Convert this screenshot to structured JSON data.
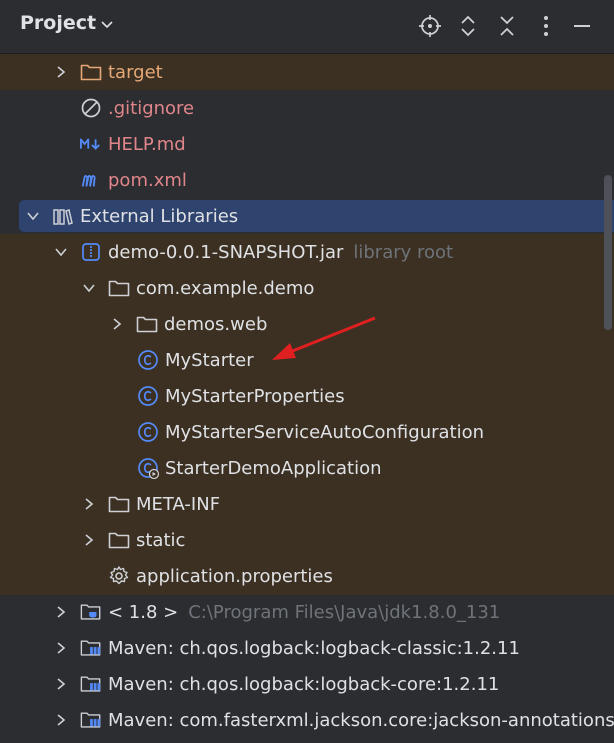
{
  "header": {
    "title": "Project"
  },
  "tree": [
    {
      "label": "target"
    },
    {
      "label": ".gitignore"
    },
    {
      "label": "HELP.md"
    },
    {
      "label": "pom.xml"
    },
    {
      "label": "External Libraries"
    },
    {
      "label": "demo-0.0.1-SNAPSHOT.jar",
      "hint": "library root"
    },
    {
      "label": "com.example.demo"
    },
    {
      "label": "demos.web"
    },
    {
      "label": "MyStarter"
    },
    {
      "label": "MyStarterProperties"
    },
    {
      "label": "MyStarterServiceAutoConfiguration"
    },
    {
      "label": "StarterDemoApplication"
    },
    {
      "label": "META-INF"
    },
    {
      "label": "static"
    },
    {
      "label": "application.properties"
    },
    {
      "label": "< 1.8 >",
      "hint": "C:\\Program Files\\Java\\jdk1.8.0_131"
    },
    {
      "label": "Maven: ch.qos.logback:logback-classic:1.2.11"
    },
    {
      "label": "Maven: ch.qos.logback:logback-core:1.2.11"
    },
    {
      "label": "Maven: com.fasterxml.jackson.core:jackson-annotations"
    }
  ],
  "colors": {
    "accent_selection": "#2e436e",
    "excluded_folder_bg": "#3b3022",
    "class_icon": "#548af7",
    "annotation_arrow": "#e02020"
  }
}
